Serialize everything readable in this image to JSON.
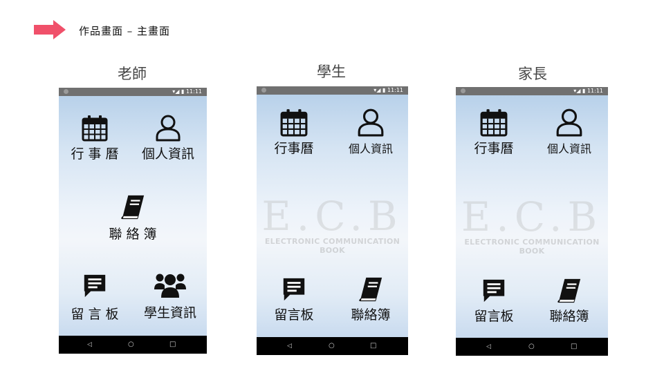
{
  "header": {
    "title": "作品畫面 – 主畫面",
    "arrow_color": "#f0506a"
  },
  "columns": [
    {
      "title": "老師",
      "status_time": "11:11",
      "items": [
        {
          "icon": "calendar-icon",
          "label": "行 事 曆"
        },
        {
          "icon": "person-icon",
          "label": "個人資訊"
        },
        {
          "icon": "book-icon",
          "label": "聯 絡 簿"
        },
        {
          "icon": "message-icon",
          "label": "留 言 板"
        },
        {
          "icon": "group-icon",
          "label": "學生資訊"
        }
      ]
    },
    {
      "title": "學生",
      "status_time": "11:11",
      "logo": {
        "main": "E.C.B",
        "sub": "ELECTRONIC COMMUNICATION BOOK"
      },
      "items": [
        {
          "icon": "calendar-icon",
          "label": "行事曆"
        },
        {
          "icon": "person-icon",
          "label": "個人資訊"
        },
        {
          "icon": "message-icon",
          "label": "留言板"
        },
        {
          "icon": "book-icon",
          "label": "聯絡簿"
        }
      ]
    },
    {
      "title": "家長",
      "status_time": "11:11",
      "logo": {
        "main": "E.C.B",
        "sub": "ELECTRONIC COMMUNICATION BOOK"
      },
      "items": [
        {
          "icon": "calendar-icon",
          "label": "行事曆"
        },
        {
          "icon": "person-icon",
          "label": "個人資訊"
        },
        {
          "icon": "message-icon",
          "label": "留言板"
        },
        {
          "icon": "book-icon",
          "label": "聯絡簿"
        }
      ]
    }
  ],
  "navbar": {
    "back": "◁",
    "home": "○",
    "recent": "□"
  }
}
